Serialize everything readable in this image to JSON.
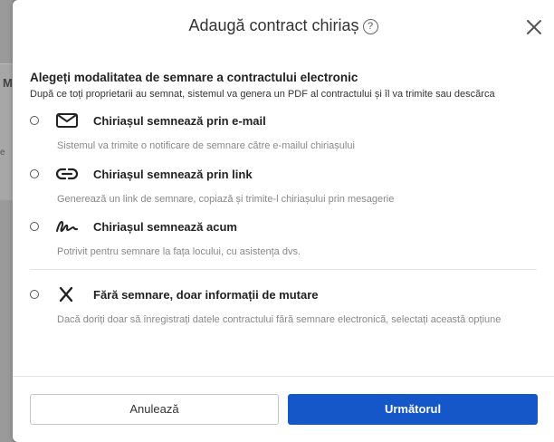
{
  "backdrop": {
    "letter": "M",
    "small": "e"
  },
  "modal": {
    "title": "Adaugă contract chiriaș",
    "help_glyph": "?",
    "section_title": "Alegeți modalitatea de semnare a contractului electronic",
    "section_desc": "După ce toți proprietarii au semnat, sistemul va genera un PDF al contractului și îl va trimite sau descărca",
    "options": [
      {
        "icon": "envelope-icon",
        "label": "Chiriașul semnează prin e-mail",
        "desc": "Sistemul va trimite o notificare de semnare către e-mailul chiriașului"
      },
      {
        "icon": "link-icon",
        "label": "Chiriașul semnează prin link",
        "desc": "Generează un link de semnare, copiază și trimite-l chiriașului prin mesagerie"
      },
      {
        "icon": "signature-icon",
        "label": "Chiriașul semnează acum",
        "desc": "Potrivit pentru semnare la fața locului, cu asistența dvs."
      },
      {
        "icon": "x-icon",
        "label": "Fără semnare, doar informații de mutare",
        "desc": "Dacă doriți doar să înregistrați datele contractului fără semnare electronică, selectați această opțiune"
      }
    ],
    "cancel_label": "Anulează",
    "next_label": "Următorul"
  },
  "colors": {
    "primary": "#1557c9",
    "muted_text": "#888888"
  }
}
